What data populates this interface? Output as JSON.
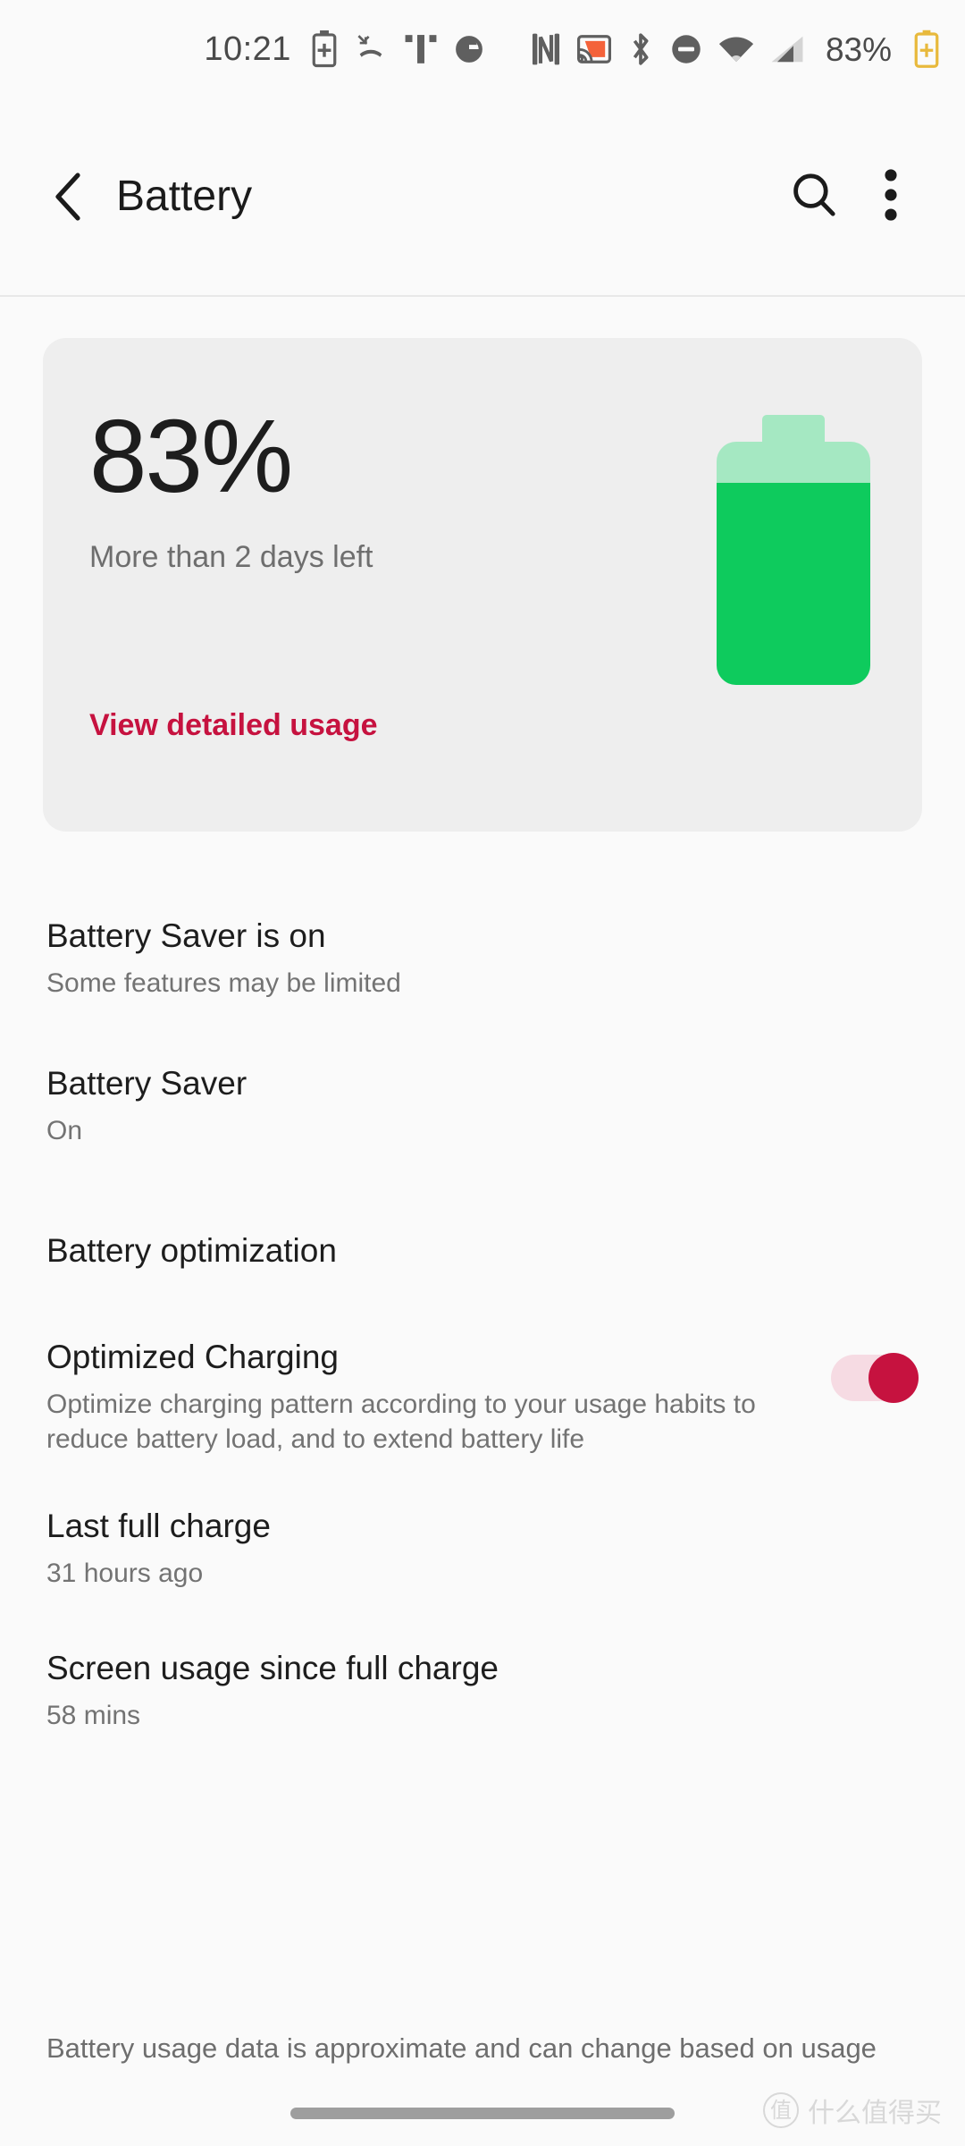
{
  "statusbar": {
    "time": "10:21",
    "battery_percent": "83%",
    "icons": [
      "battery-saver-icon",
      "missed-call-icon",
      "t-mobile-icon",
      "google-icon",
      "nfc-icon",
      "cast-icon",
      "bluetooth-icon",
      "do-not-disturb-icon",
      "wifi-icon",
      "cellular-signal-icon"
    ]
  },
  "appbar": {
    "back_label": "Back",
    "title": "Battery",
    "search_label": "Search",
    "more_label": "More options"
  },
  "battery_card": {
    "percent": "83%",
    "percent_value": 83,
    "time_left": "More than 2 days left",
    "detail_link": "View detailed usage",
    "fill_color": "#0ecb5d",
    "track_color": "#a5e8c2",
    "card_color": "#eeeeee"
  },
  "preferences": [
    {
      "title": "Battery Saver is on",
      "summary": "Some features may be limited"
    },
    {
      "title": "Battery Saver",
      "summary": "On"
    }
  ],
  "section": {
    "header": "Battery optimization"
  },
  "optimized_charging": {
    "title": "Optimized Charging",
    "summary": "Optimize charging pattern according to your usage habits to reduce battery load, and to extend battery life",
    "toggle_state": "on",
    "accent_color": "#c6123f"
  },
  "stats": [
    {
      "title": "Last full charge",
      "summary": "31 hours ago"
    },
    {
      "title": "Screen usage since full charge",
      "summary": "58 mins"
    }
  ],
  "footer": {
    "note": "Battery usage data is approximate and can change based on usage",
    "watermark_badge": "值",
    "watermark_text": "什么值得买"
  }
}
